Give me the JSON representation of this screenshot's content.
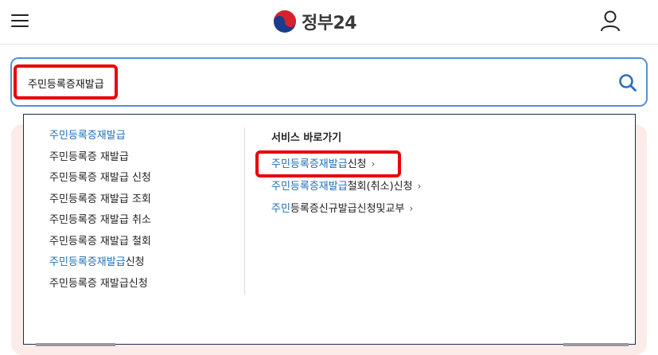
{
  "header": {
    "logo_text": "정부24",
    "menu_icon": "hamburger-menu-icon",
    "user_icon": "user-icon"
  },
  "search": {
    "value": "주민등록증재발급",
    "icon": "search-icon"
  },
  "suggestions": [
    {
      "hl": "주민등록증재발급",
      "rest": ""
    },
    {
      "hl": "",
      "rest": "주민등록증 재발급"
    },
    {
      "hl": "",
      "rest": "주민등록증 재발급 신청"
    },
    {
      "hl": "",
      "rest": "주민등록증 재발급 조회"
    },
    {
      "hl": "",
      "rest": "주민등록증 재발급 취소"
    },
    {
      "hl": "",
      "rest": "주민등록증 재발급 철회"
    },
    {
      "hl": "주민등록증재발급",
      "rest": "신청"
    },
    {
      "hl": "",
      "rest": "주민등록증 재발급신청"
    }
  ],
  "services": {
    "title": "서비스 바로가기",
    "items": [
      {
        "hl": "주민등록증재발급",
        "rest": "신청"
      },
      {
        "hl": "주민등록증재발급",
        "rest": "철회(취소)신청"
      },
      {
        "hl": "주민",
        "rest": "등록증신규발급신청및교부"
      }
    ],
    "chevron": "›"
  },
  "colors": {
    "accent": "#1d6fb8",
    "search_border": "#5b8fd0",
    "annotation_red": "#e8000b",
    "panel_bg": "#fcece9"
  }
}
